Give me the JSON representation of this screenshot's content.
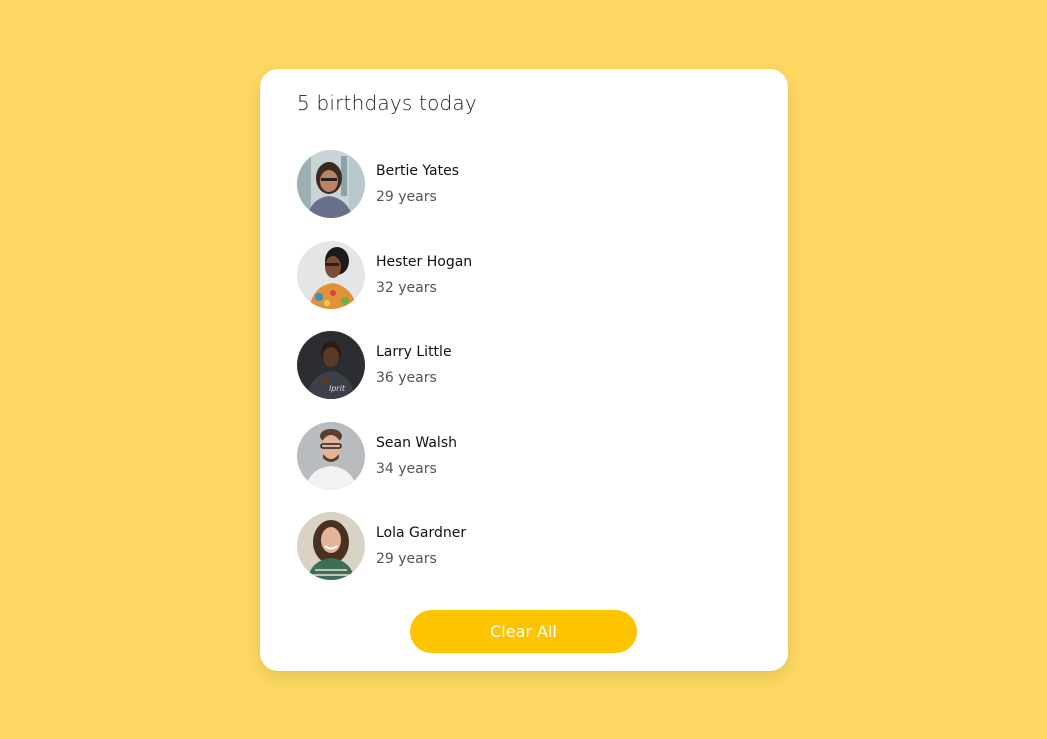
{
  "header": {
    "title": "5 birthdays today"
  },
  "people": [
    {
      "name": "Bertie Yates",
      "age": "29 years"
    },
    {
      "name": "Hester Hogan",
      "age": "32 years"
    },
    {
      "name": "Larry Little",
      "age": "36 years"
    },
    {
      "name": "Sean Walsh",
      "age": "34 years"
    },
    {
      "name": "Lola Gardner",
      "age": "29 years"
    }
  ],
  "actions": {
    "clear_label": "Clear All"
  },
  "colors": {
    "background": "#fdd862",
    "card": "#ffffff",
    "button": "#fdc500"
  }
}
